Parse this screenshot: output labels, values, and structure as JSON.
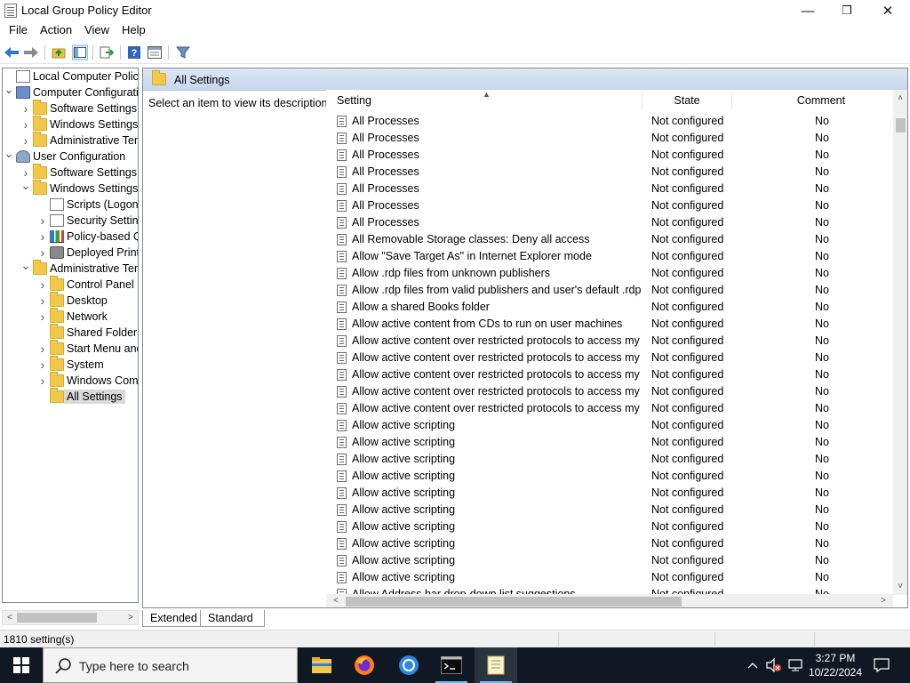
{
  "window": {
    "title": "Local Group Policy Editor",
    "minimize": "—",
    "maximize": "❐",
    "close": "✕"
  },
  "menu": [
    "File",
    "Action",
    "View",
    "Help"
  ],
  "tree": [
    {
      "label": "Local Computer Policy",
      "level": 0,
      "icon": "doc",
      "arrow": ""
    },
    {
      "label": "Computer Configuration",
      "level": 0,
      "icon": "computer",
      "arrow": "v"
    },
    {
      "label": "Software Settings",
      "level": 1,
      "icon": "folder",
      "arrow": ">"
    },
    {
      "label": "Windows Settings",
      "level": 1,
      "icon": "folder",
      "arrow": ">"
    },
    {
      "label": "Administrative Templates",
      "level": 1,
      "icon": "folder",
      "arrow": ">"
    },
    {
      "label": "User Configuration",
      "level": 0,
      "icon": "user",
      "arrow": "v"
    },
    {
      "label": "Software Settings",
      "level": 1,
      "icon": "folder",
      "arrow": ">"
    },
    {
      "label": "Windows Settings",
      "level": 1,
      "icon": "folder",
      "arrow": "v"
    },
    {
      "label": "Scripts (Logon/Logoff)",
      "level": 2,
      "icon": "doc",
      "arrow": ""
    },
    {
      "label": "Security Settings",
      "level": 2,
      "icon": "doc",
      "arrow": ">"
    },
    {
      "label": "Policy-based QoS",
      "level": 2,
      "icon": "chart",
      "arrow": ">"
    },
    {
      "label": "Deployed Printers",
      "level": 2,
      "icon": "printer",
      "arrow": ">"
    },
    {
      "label": "Administrative Templates",
      "level": 1,
      "icon": "folder",
      "arrow": "v"
    },
    {
      "label": "Control Panel",
      "level": 2,
      "icon": "folder",
      "arrow": ">"
    },
    {
      "label": "Desktop",
      "level": 2,
      "icon": "folder",
      "arrow": ">"
    },
    {
      "label": "Network",
      "level": 2,
      "icon": "folder",
      "arrow": ">"
    },
    {
      "label": "Shared Folders",
      "level": 2,
      "icon": "folder",
      "arrow": ""
    },
    {
      "label": "Start Menu and Taskbar",
      "level": 2,
      "icon": "folder",
      "arrow": ">"
    },
    {
      "label": "System",
      "level": 2,
      "icon": "folder",
      "arrow": ">"
    },
    {
      "label": "Windows Components",
      "level": 2,
      "icon": "folder",
      "arrow": ">"
    },
    {
      "label": "All Settings",
      "level": 2,
      "icon": "folder",
      "arrow": "",
      "selected": true
    }
  ],
  "pane": {
    "title": "All Settings",
    "description": "Select an item to view its description."
  },
  "columns": {
    "setting": "Setting",
    "state": "State",
    "comment": "Comment"
  },
  "rows": [
    {
      "setting": "All Processes",
      "state": "Not configured",
      "comment": "No"
    },
    {
      "setting": "All Processes",
      "state": "Not configured",
      "comment": "No"
    },
    {
      "setting": "All Processes",
      "state": "Not configured",
      "comment": "No"
    },
    {
      "setting": "All Processes",
      "state": "Not configured",
      "comment": "No"
    },
    {
      "setting": "All Processes",
      "state": "Not configured",
      "comment": "No"
    },
    {
      "setting": "All Processes",
      "state": "Not configured",
      "comment": "No"
    },
    {
      "setting": "All Processes",
      "state": "Not configured",
      "comment": "No"
    },
    {
      "setting": "All Removable Storage classes: Deny all access",
      "state": "Not configured",
      "comment": "No"
    },
    {
      "setting": "Allow \"Save Target As\" in Internet Explorer mode",
      "state": "Not configured",
      "comment": "No"
    },
    {
      "setting": "Allow .rdp files from unknown publishers",
      "state": "Not configured",
      "comment": "No"
    },
    {
      "setting": "Allow .rdp files from valid publishers and user's default .rdp ...",
      "state": "Not configured",
      "comment": "No"
    },
    {
      "setting": "Allow a shared Books folder",
      "state": "Not configured",
      "comment": "No"
    },
    {
      "setting": "Allow active content from CDs to run on user machines",
      "state": "Not configured",
      "comment": "No"
    },
    {
      "setting": "Allow active content over restricted protocols to access my ...",
      "state": "Not configured",
      "comment": "No"
    },
    {
      "setting": "Allow active content over restricted protocols to access my ...",
      "state": "Not configured",
      "comment": "No"
    },
    {
      "setting": "Allow active content over restricted protocols to access my ...",
      "state": "Not configured",
      "comment": "No"
    },
    {
      "setting": "Allow active content over restricted protocols to access my ...",
      "state": "Not configured",
      "comment": "No"
    },
    {
      "setting": "Allow active content over restricted protocols to access my ...",
      "state": "Not configured",
      "comment": "No"
    },
    {
      "setting": "Allow active scripting",
      "state": "Not configured",
      "comment": "No"
    },
    {
      "setting": "Allow active scripting",
      "state": "Not configured",
      "comment": "No"
    },
    {
      "setting": "Allow active scripting",
      "state": "Not configured",
      "comment": "No"
    },
    {
      "setting": "Allow active scripting",
      "state": "Not configured",
      "comment": "No"
    },
    {
      "setting": "Allow active scripting",
      "state": "Not configured",
      "comment": "No"
    },
    {
      "setting": "Allow active scripting",
      "state": "Not configured",
      "comment": "No"
    },
    {
      "setting": "Allow active scripting",
      "state": "Not configured",
      "comment": "No"
    },
    {
      "setting": "Allow active scripting",
      "state": "Not configured",
      "comment": "No"
    },
    {
      "setting": "Allow active scripting",
      "state": "Not configured",
      "comment": "No"
    },
    {
      "setting": "Allow active scripting",
      "state": "Not configured",
      "comment": "No"
    },
    {
      "setting": "Allow Address bar drop-down list suggestions",
      "state": "Not configured",
      "comment": "No"
    }
  ],
  "tabs": {
    "extended": "Extended",
    "standard": "Standard"
  },
  "status": {
    "count": "1810 setting(s)"
  },
  "taskbar": {
    "search_placeholder": "Type here to search",
    "time": "3:27 PM",
    "date": "10/22/2024",
    "accent": "#76b9ed"
  },
  "icons": [
    "back-icon",
    "forward-icon",
    "up-folder-icon",
    "show-hide-tree-icon",
    "export-list-icon",
    "help-icon",
    "properties-icon",
    "filter-icon"
  ]
}
